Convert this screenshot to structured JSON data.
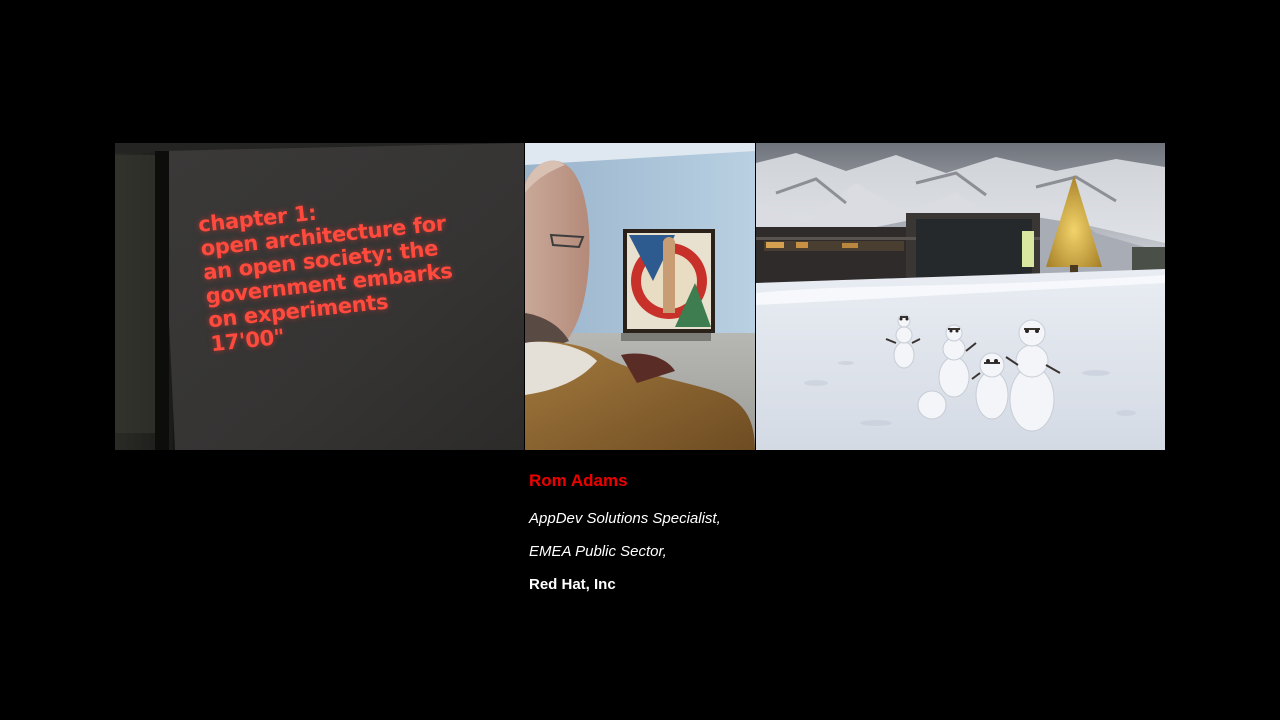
{
  "slide": {
    "background": "#000000",
    "accent": "#ee0000"
  },
  "photos": {
    "screen": {
      "lines": [
        "chapter 1:",
        "open architecture for",
        "an open society: the",
        "government embarks",
        "on experiments",
        "17'00\""
      ],
      "text_color": "#ff4a3d"
    }
  },
  "speaker": {
    "name": "Rom Adams",
    "title_line1": "AppDev Solutions Specialist,",
    "title_line2": "EMEA Public Sector,",
    "company": "Red Hat, Inc"
  }
}
